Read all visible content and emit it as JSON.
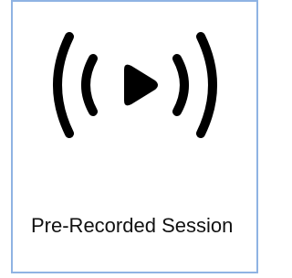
{
  "card": {
    "label": "Pre-Recorded Session",
    "icon": "broadcast-play-icon",
    "border_color": "#8fb3e3",
    "icon_color": "#000000"
  }
}
